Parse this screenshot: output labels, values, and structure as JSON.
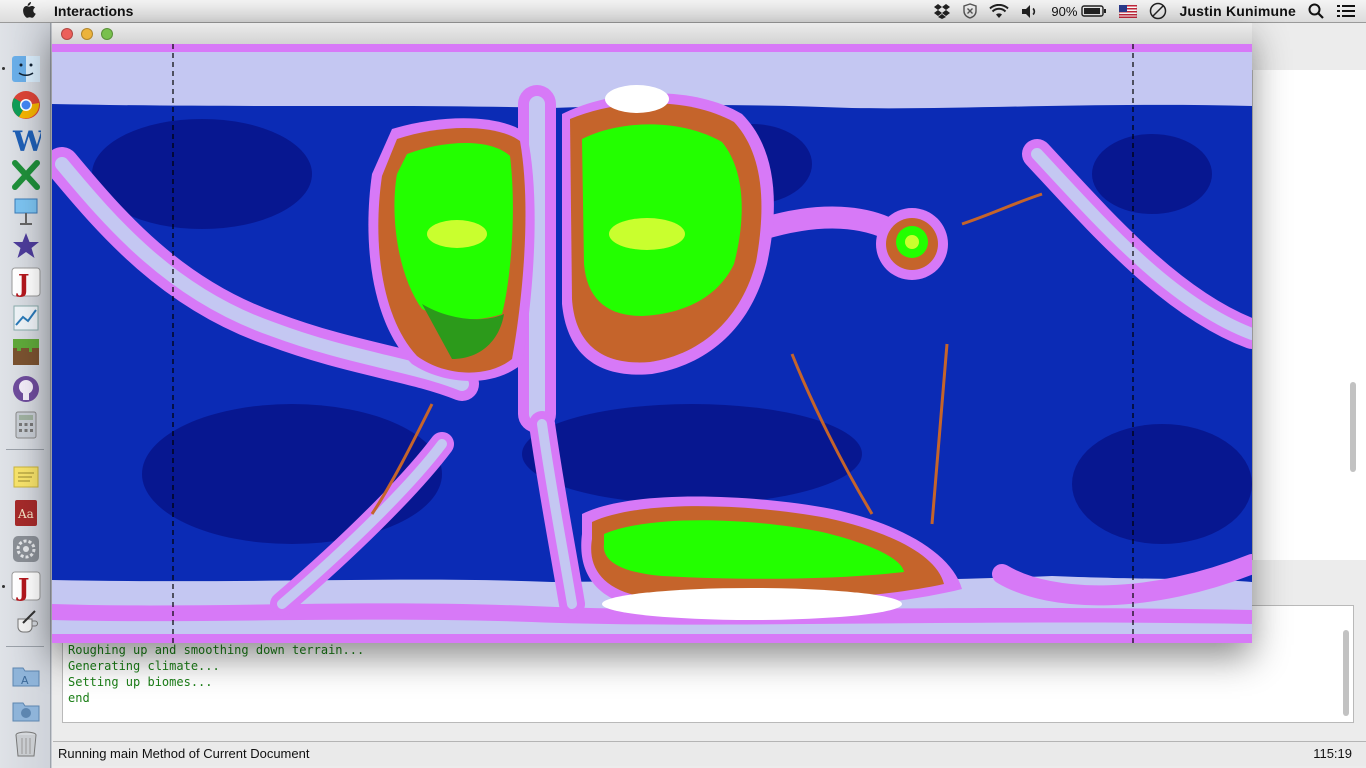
{
  "menubar": {
    "app_name": "Interactions",
    "battery_text": "90%",
    "user_name": "Justin Kunimune",
    "icons": [
      "apple-icon",
      "dropbox-icon",
      "shield-icon",
      "wifi-icon",
      "volume-icon",
      "battery-icon",
      "us-flag-icon",
      "clock-icon",
      "search-icon",
      "list-icon"
    ]
  },
  "dock": {
    "icons": [
      "finder-icon",
      "chrome-icon",
      "word-icon",
      "excel-icon",
      "keynote-icon",
      "imovie-icon",
      "java-icon",
      "instruments-icon",
      "minecraft-icon",
      "github-icon",
      "calculator-icon",
      "stickies-icon",
      "dictionary-icon",
      "system-preferences-icon",
      "java-icon",
      "coffee-icon",
      "applications-folder-icon",
      "downloads-folder-icon",
      "trash-icon"
    ]
  },
  "window": {
    "title": "",
    "buttons": [
      "close",
      "minimize",
      "zoom"
    ],
    "map_colors": {
      "ocean": "#0b2bb5",
      "deep_ocean": "#07148a",
      "ice": "#c4c7f2",
      "tundra": "#d779f7",
      "land": "#23ff00",
      "desert": "#c5642b",
      "snow": "#ffffff",
      "forest": "#2c9a1b",
      "highland": "#c9ff2e"
    }
  },
  "console": {
    "lines": [
      "Roughing up and smoothing down terrain...",
      "Generating climate...",
      "Setting up biomes...",
      "end"
    ],
    "text_color": "#1b7f17"
  },
  "statusbar": {
    "message": "Running main Method of Current Document",
    "position": "115:19"
  }
}
